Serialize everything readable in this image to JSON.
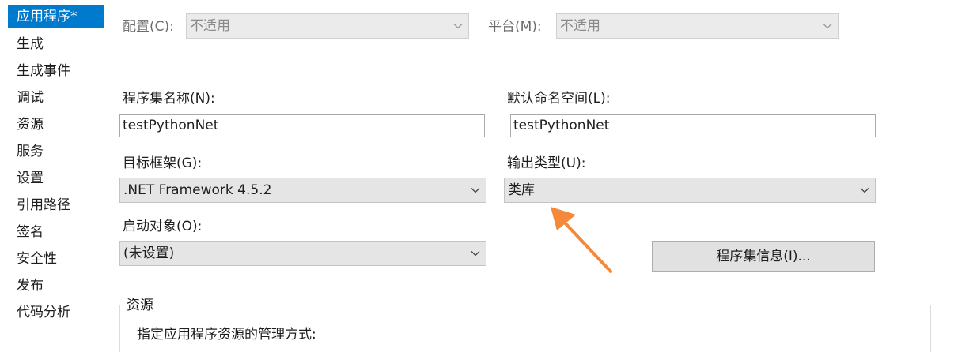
{
  "sidebar": {
    "items": [
      {
        "label": "应用程序*",
        "active": true
      },
      {
        "label": "生成"
      },
      {
        "label": "生成事件"
      },
      {
        "label": "调试"
      },
      {
        "label": "资源"
      },
      {
        "label": "服务"
      },
      {
        "label": "设置"
      },
      {
        "label": "引用路径"
      },
      {
        "label": "签名"
      },
      {
        "label": "安全性"
      },
      {
        "label": "发布"
      },
      {
        "label": "代码分析"
      }
    ]
  },
  "header": {
    "config_label": "配置(C):",
    "config_value": "不适用",
    "platform_label": "平台(M):",
    "platform_value": "不适用"
  },
  "form": {
    "assembly_name_label": "程序集名称(N):",
    "assembly_name_value": "testPythonNet",
    "default_namespace_label": "默认命名空间(L):",
    "default_namespace_value": "testPythonNet",
    "target_framework_label": "目标框架(G):",
    "target_framework_value": ".NET Framework 4.5.2",
    "output_type_label": "输出类型(U):",
    "output_type_value": "类库",
    "startup_object_label": "启动对象(O):",
    "startup_object_value": "(未设置)",
    "assembly_info_button": "程序集信息(I)..."
  },
  "resources": {
    "title": "资源",
    "description": "指定应用程序资源的管理方式:"
  },
  "colors": {
    "accent": "#007acc",
    "annotation_arrow": "#f5883a"
  }
}
